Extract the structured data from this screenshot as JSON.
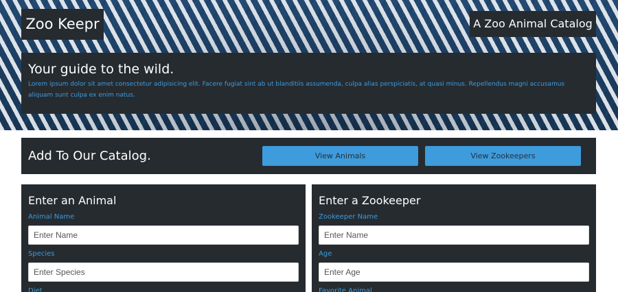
{
  "header": {
    "brand": "Zoo Keepr",
    "tagline": "A Zoo Animal Catalog",
    "intro_title": "Your guide to the wild.",
    "intro_text": "Lorem ipsum dolor sit amet consectetur adipisicing elit. Facere fugiat sint ab ut blanditiis assumenda, culpa alias perspiciatis, at quasi minus. Repellendus magni accusamus aliquam sunt culpa ex enim natus."
  },
  "add_bar": {
    "title": "Add To Our Catalog.",
    "view_animals_label": "View Animals",
    "view_zookeepers_label": "View Zookeepers"
  },
  "animal_form": {
    "title": "Enter an Animal",
    "name_label": "Animal Name",
    "name_placeholder": "Enter Name",
    "name_value": "",
    "species_label": "Species",
    "species_placeholder": "Enter Species",
    "species_value": "",
    "diet_label": "Diet"
  },
  "zookeeper_form": {
    "title": "Enter a Zookeeper",
    "name_label": "Zookeeper Name",
    "name_placeholder": "Enter Name",
    "name_value": "",
    "age_label": "Age",
    "age_placeholder": "Enter Age",
    "age_value": "",
    "favorite_animal_label": "Favorite Animal"
  },
  "colors": {
    "panel": "#262b30",
    "accent": "#3e9bdc",
    "hero_base": "#1c3f63"
  },
  "icons": {
    "hero_background": "zebra-stripes-image"
  }
}
